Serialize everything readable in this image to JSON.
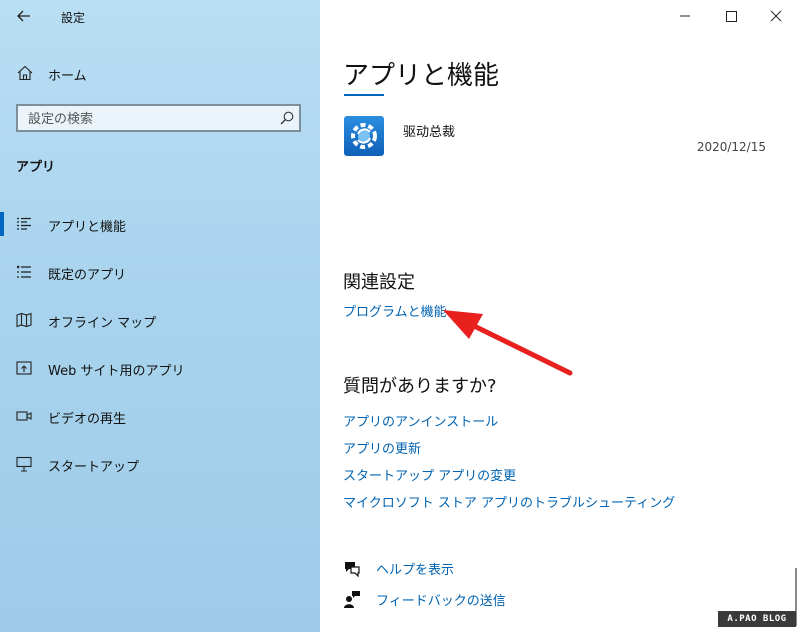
{
  "window": {
    "title": "設定",
    "controls": {
      "minimize": "minimize-icon",
      "maximize": "maximize-icon",
      "close": "close-icon"
    }
  },
  "sidebar": {
    "home_label": "ホーム",
    "search_placeholder": "設定の検索",
    "section_title": "アプリ",
    "items": [
      {
        "label": "アプリと機能",
        "icon": "apps-features-icon",
        "selected": true
      },
      {
        "label": "既定のアプリ",
        "icon": "default-apps-icon",
        "selected": false
      },
      {
        "label": "オフライン マップ",
        "icon": "offline-maps-icon",
        "selected": false
      },
      {
        "label": "Web サイト用のアプリ",
        "icon": "apps-for-websites-icon",
        "selected": false
      },
      {
        "label": "ビデオの再生",
        "icon": "video-playback-icon",
        "selected": false
      },
      {
        "label": "スタートアップ",
        "icon": "startup-icon",
        "selected": false
      }
    ]
  },
  "main": {
    "page_title": "アプリと機能",
    "app": {
      "name": "驱动总裁",
      "date": "2020/12/15"
    },
    "related_title": "関連設定",
    "related_link": "プログラムと機能",
    "questions_title": "質問がありますか?",
    "question_links": [
      "アプリのアンインストール",
      "アプリの更新",
      "スタートアップ アプリの変更",
      "マイクロソフト ストア アプリのトラブルシューティング"
    ],
    "help_label": "ヘルプを表示",
    "feedback_label": "フィードバックの送信"
  },
  "annotation": {
    "arrow_color": "#e8201e"
  },
  "watermark": "A.PAO BLOG",
  "colors": {
    "accent": "#0067c0",
    "link": "#0063b1"
  }
}
